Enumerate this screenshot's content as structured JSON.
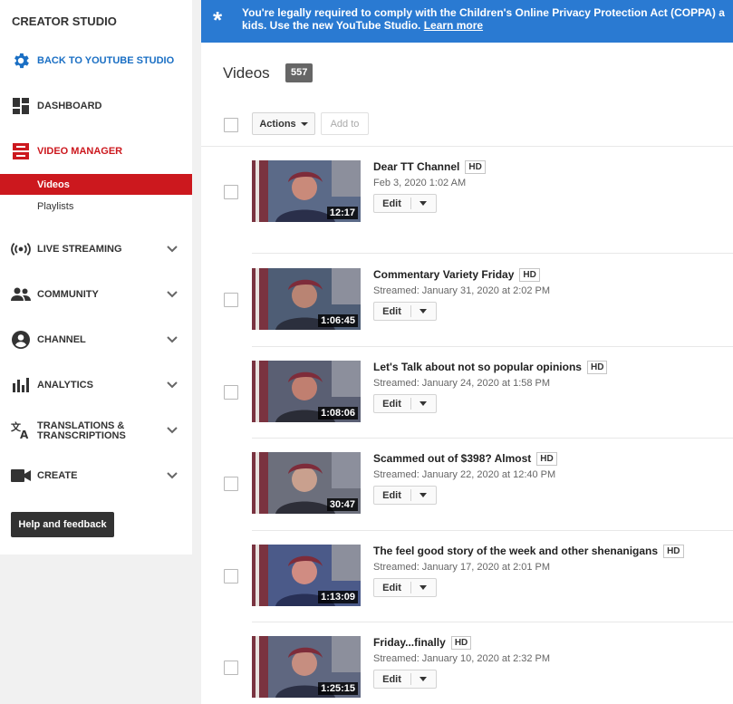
{
  "sidebar": {
    "title": "CREATOR STUDIO",
    "back": "BACK TO YOUTUBE STUDIO",
    "dashboard": "DASHBOARD",
    "video_manager": "VIDEO MANAGER",
    "sub_videos": "Videos",
    "sub_playlists": "Playlists",
    "live_streaming": "LIVE STREAMING",
    "community": "COMMUNITY",
    "channel": "CHANNEL",
    "analytics": "ANALYTICS",
    "translations_line1": "TRANSLATIONS &",
    "translations_line2": "TRANSCRIPTIONS",
    "create": "CREATE",
    "help": "Help and feedback"
  },
  "banner": {
    "line1": "You're legally required to comply with the Children's Online Privacy Protection Act (COPPA) a",
    "line2": "kids. Use the new YouTube Studio.",
    "link": "Learn more"
  },
  "main": {
    "title": "Videos",
    "count": "557",
    "actions": "Actions",
    "add_to": "Add to",
    "edit_label": "Edit",
    "hd_label": "HD",
    "videos": [
      {
        "title": "Dear TT Channel",
        "date": "Feb 3, 2020 1:02 AM",
        "duration": "12:17"
      },
      {
        "title": "Commentary Variety Friday",
        "date": "Streamed: January 31, 2020 at 2:02 PM",
        "duration": "1:06:45"
      },
      {
        "title": "Let's Talk about not so popular opinions",
        "date": "Streamed: January 24, 2020 at 1:58 PM",
        "duration": "1:08:06"
      },
      {
        "title": "Scammed out of $398? Almost",
        "date": "Streamed: January 22, 2020 at 12:40 PM",
        "duration": "30:47"
      },
      {
        "title": "The feel good story of the week and other shenanigans",
        "date": "Streamed: January 17, 2020 at 2:01 PM",
        "duration": "1:13:09"
      },
      {
        "title": "Friday...finally",
        "date": "Streamed: January 10, 2020 at 2:32 PM",
        "duration": "1:25:15"
      }
    ]
  },
  "colors": {
    "accent_red": "#cc181e",
    "link_blue": "#1a6fc4",
    "banner_blue": "#2a7ad2"
  }
}
